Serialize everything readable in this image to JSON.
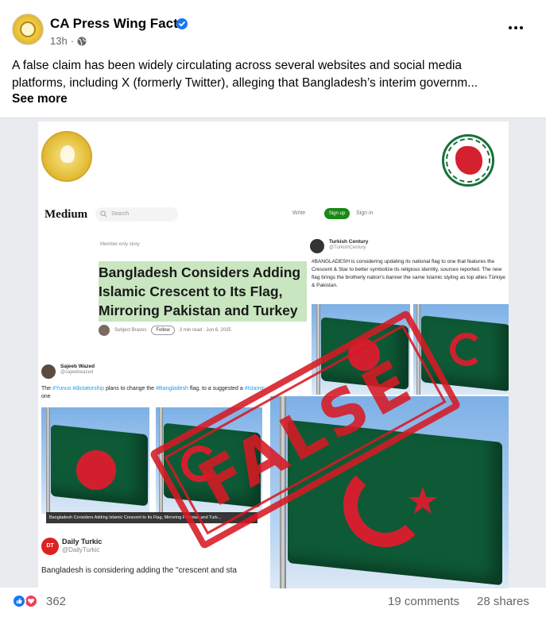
{
  "post": {
    "page_name": "CA Press Wing Facts",
    "time": "13h",
    "visibility_icon": "globe-icon",
    "text_line1": "A false claim has been widely circulating across several websites and social media",
    "text_line2": "platforms, including X (formerly Twitter), alleging that Bangladesh’s interim governm...",
    "see_more": "See more"
  },
  "image": {
    "medium": {
      "logo": "Medium",
      "search_placeholder": "Search",
      "write": "Write",
      "signup": "Sign up",
      "signin": "Sign in",
      "member_only": "Member-only story",
      "article_title": "Bangladesh Considers Adding Islamic Crescent to Its Flag, Mirroring Pakistan and Turkey",
      "author": "Subject Bravos",
      "follow": "Follow",
      "read_meta": "3 min read · Jun 6, 2025"
    },
    "turkish_tweet": {
      "name": "Turkish Century",
      "handle": "@TurkishCentury",
      "text": "#BANGLADESH is considering updating its national flag to one that features the Crescent & Star to better symbolize its religious identity, sources reported. The new flag brings the brotherly nation's banner the same Islamic styling as top allies Türkiye & Pakistan."
    },
    "sajeeb_tweet": {
      "name": "Sajeeb Wazed",
      "handle": "@sajeebwazed",
      "text_prefix": "The ",
      "tag1": "#Yunus #dictatorship",
      "text_mid": " plans to change the ",
      "tag2": "#Bangladesh",
      "text_suffix": " flag, to a suggested a ",
      "tag3": "#Islamic",
      "text_end": " one"
    },
    "caption": "Bangladesh Considers Adding Islamic Crescent to Its Flag, Mirroring Pakistan and Turk...",
    "daily_turkic": {
      "avatar_text": "DT",
      "name": "Daily Turkic",
      "handle": "@DailyTurkic",
      "text": "Bangladesh is considering adding the \"crescent and sta"
    },
    "stamp": "FALSE",
    "colors": {
      "stamp_red": "#d71923",
      "flag_green": "#0e5a36",
      "flag_red": "#d21f2e"
    }
  },
  "footer": {
    "reactions": "362",
    "comments": "19 comments",
    "shares": "28 shares"
  }
}
